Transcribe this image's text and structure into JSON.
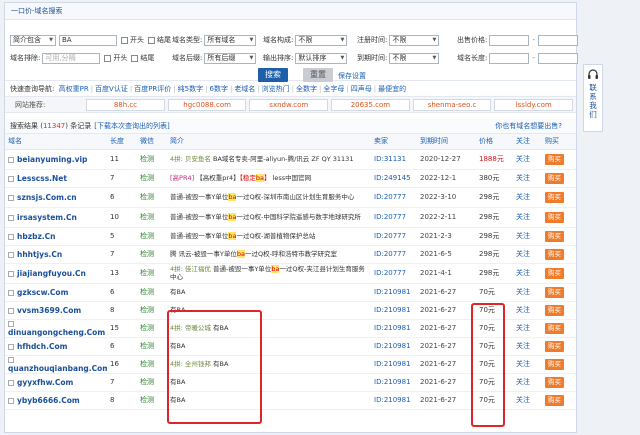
{
  "title": "一口价-域名搜索",
  "form": {
    "row1": {
      "pkg_value": "简介包含",
      "keyword_value": "BA",
      "opt_start": "开头",
      "opt_end": "结尾",
      "type_label": "域名类型:",
      "type_value": "所有域名",
      "build_label": "域名构成:",
      "build_value": "不限",
      "reg_label": "注册时间:",
      "reg_value": "不限",
      "price_label": "出售价格:",
      "dash": "-"
    },
    "row2": {
      "exclude_label": "域名排除:",
      "exclude_placeholder": "可用,分隔",
      "opt_start": "开头",
      "opt_end": "结尾",
      "suffix_label": "域名后缀:",
      "suffix_value": "所有后缀",
      "sort_label": "输出排序:",
      "sort_value": "默认排序",
      "exp_label": "到期时间:",
      "exp_value": "不限",
      "len_label": "域名长度:",
      "dash": "-"
    },
    "search_btn": "搜索",
    "reset_btn": "重置",
    "save_link": "保存设置"
  },
  "quick": {
    "label": "快速查询导航:",
    "links": [
      "高权重PR",
      "百度V认证",
      "百度PR评价",
      "纯5数字",
      "6数字",
      "老域名",
      "浏览热门",
      "全数字",
      "全字母",
      "四声母",
      "最便宜的"
    ]
  },
  "recommend": {
    "label": "网站推荐:",
    "sites": [
      "88h.cc",
      "hgc0088.com",
      "sxndw.com",
      "20635.com",
      "shenma-seo.c",
      "lssldy.com"
    ]
  },
  "results": {
    "prefix": "搜索结果 (",
    "count": "11347",
    "suffix": ") 条记录",
    "download": "[下载本次查询出的列表]",
    "right_link": "你也有域名想要出售?"
  },
  "table": {
    "headers": [
      "域名",
      "长度",
      "微信",
      "简介",
      "卖家",
      "到期时间",
      "价格",
      "关注",
      "购买"
    ],
    "check_label": "检测",
    "follow_label": "关注",
    "buy_label": "购买",
    "rows": [
      {
        "domain": "beianyuming.vip",
        "len": "11",
        "seg": [
          [
            "tag",
            "4拼: "
          ],
          [
            "tag",
            "贝安鱼名 "
          ],
          [
            "",
            "BA域名专卖-阿里-aliyun-腾/讯云 ZF QY 31131"
          ]
        ],
        "seller": "ID:31131",
        "date": "2020-12-27",
        "price": "1888元",
        "hot": true,
        "tall": true
      },
      {
        "domain": "Lesscss.Net",
        "len": "7",
        "seg": [
          [
            "pink",
            "[高PR4]"
          ],
          [
            "",
            " 【高权重pr4】"
          ],
          [
            "red",
            "【稳定"
          ],
          [
            "hl",
            "ba"
          ],
          [
            "red",
            "】"
          ],
          [
            "",
            " less中国官网"
          ]
        ],
        "seller": "ID:249145",
        "date": "2022-12-1",
        "price": "380元",
        "hot": false,
        "tall": false
      },
      {
        "domain": "sznsjs.Com.cn",
        "len": "6",
        "seg": [
          [
            "",
            "普通-被毁一事Y单位"
          ],
          [
            "hl",
            "ba"
          ],
          [
            "",
            "一过Q权-深圳市南山区计划生育服务中心"
          ]
        ],
        "seller": "ID:20777",
        "date": "2022-3-10",
        "price": "298元",
        "hot": false,
        "tall": true
      },
      {
        "domain": "irsasystem.Cn",
        "len": "10",
        "seg": [
          [
            "",
            "普通-被毁一事Y单位"
          ],
          [
            "hl",
            "ba"
          ],
          [
            "",
            "一过Q权-中国科学院遥感与数字地球研究所"
          ]
        ],
        "seller": "ID:20777",
        "date": "2022-2-11",
        "price": "298元",
        "hot": false,
        "tall": true
      },
      {
        "domain": "hbzbz.Cn",
        "len": "5",
        "seg": [
          [
            "",
            "普通-被毁一事Y单位"
          ],
          [
            "hl",
            "ba"
          ],
          [
            "",
            "一过Q权-湖普植物保护总站"
          ]
        ],
        "seller": "ID:20777",
        "date": "2021-2-3",
        "price": "298元",
        "hot": false,
        "tall": false
      },
      {
        "domain": "hhhtjys.Cn",
        "len": "7",
        "seg": [
          [
            "",
            "腾 讯云-被毁一事Y单位"
          ],
          [
            "hl",
            "ba"
          ],
          [
            "",
            "一过Q权-呼和浩特市教学研究室"
          ]
        ],
        "seller": "ID:20777",
        "date": "2021-6-5",
        "price": "298元",
        "hot": false,
        "tall": false
      },
      {
        "domain": "jiajiangfuyou.Cn",
        "len": "13",
        "seg": [
          [
            "tag",
            "4拼: "
          ],
          [
            "tag",
            "佳江福优 "
          ],
          [
            "",
            "普通-被毁一事Y单位"
          ],
          [
            "hl",
            "ba"
          ],
          [
            "",
            "一过Q权-夹江县计划生育服务中心"
          ]
        ],
        "seller": "ID:20777",
        "date": "2021-4-1",
        "price": "298元",
        "hot": false,
        "tall": true
      },
      {
        "domain": "gzkscw.Com",
        "len": "6",
        "seg": [
          [
            "",
            "有BA"
          ]
        ],
        "seller": "ID:210981",
        "date": "2021-6-27",
        "price": "70元",
        "hot": false,
        "tall": false
      },
      {
        "domain": "vvsm3699.Com",
        "len": "8",
        "seg": [
          [
            "",
            "有BA"
          ]
        ],
        "seller": "ID:210981",
        "date": "2021-6-27",
        "price": "70元",
        "hot": false,
        "tall": false
      },
      {
        "domain": "dinuangongcheng.Com",
        "len": "15",
        "seg": [
          [
            "tag",
            "4拼: "
          ],
          [
            "tag",
            "帝暖公城 "
          ],
          [
            "",
            "有BA"
          ]
        ],
        "seller": "ID:210981",
        "date": "2021-6-27",
        "price": "70元",
        "hot": false,
        "tall": false
      },
      {
        "domain": "hfhdch.Com",
        "len": "6",
        "seg": [
          [
            "",
            "有BA"
          ]
        ],
        "seller": "ID:210981",
        "date": "2021-6-27",
        "price": "70元",
        "hot": false,
        "tall": false
      },
      {
        "domain": "quanzhouqianbang.Com",
        "len": "16",
        "seg": [
          [
            "tag",
            "4拼: "
          ],
          [
            "tag",
            "全州钱邦 "
          ],
          [
            "",
            "有BA"
          ]
        ],
        "seller": "ID:210981",
        "date": "2021-6-27",
        "price": "70元",
        "hot": false,
        "tall": false
      },
      {
        "domain": "gyyxfhw.Com",
        "len": "7",
        "seg": [
          [
            "",
            "有BA"
          ]
        ],
        "seller": "ID:210981",
        "date": "2021-6-27",
        "price": "70元",
        "hot": false,
        "tall": false
      },
      {
        "domain": "ybyb6666.Com",
        "len": "8",
        "seg": [
          [
            "",
            "有BA"
          ]
        ],
        "seller": "ID:210981",
        "date": "2021-6-27",
        "price": "70元",
        "hot": false,
        "tall": false
      }
    ]
  },
  "side": {
    "text": "联系我们",
    "icon": "headset-icon"
  },
  "colors": {
    "accent": "#1d5fa9",
    "buy": "#f07b2a",
    "highlight_box": "#e2232a",
    "price_hot": "#e0101a"
  }
}
